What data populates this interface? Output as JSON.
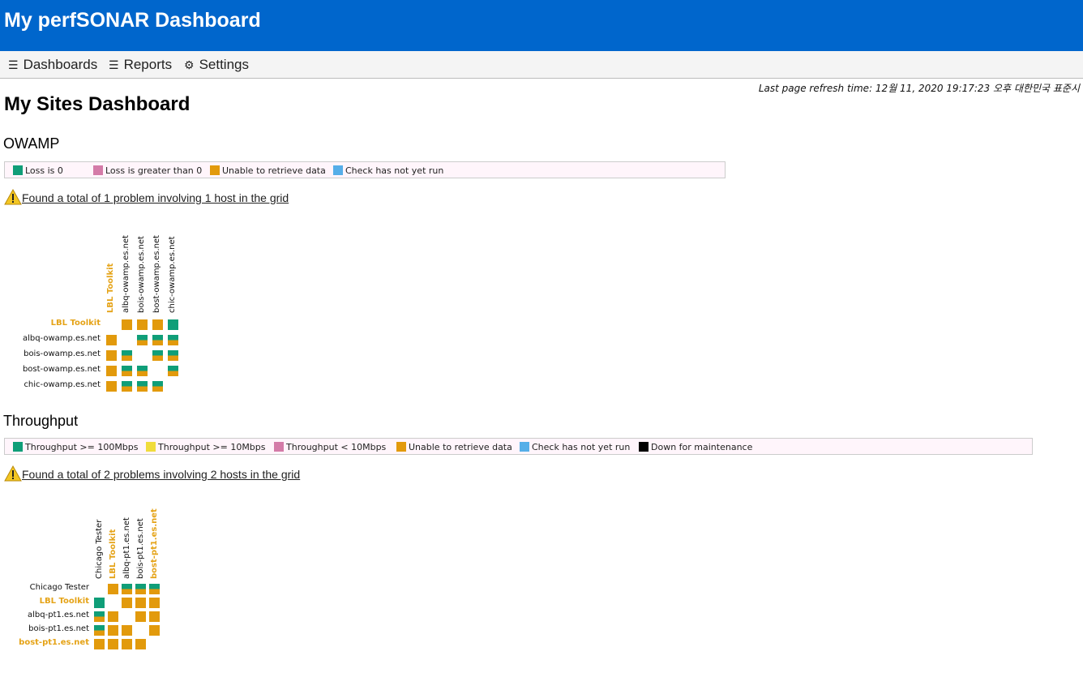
{
  "app": {
    "title": "My perfSONAR Dashboard"
  },
  "nav": [
    {
      "icon": "☰",
      "label": "Dashboards",
      "icon_name": "menu-icon"
    },
    {
      "icon": "☰",
      "label": "Reports",
      "icon_name": "list-icon"
    },
    {
      "icon": "⚙",
      "label": "Settings",
      "icon_name": "gear-icon"
    }
  ],
  "refresh": {
    "text": "Last page refresh time: 12월 11, 2020 19:17:23 오후 대한민국 표준시"
  },
  "page": {
    "title": "My Sites Dashboard"
  },
  "colors": {
    "green": "#0f9e78",
    "pink": "#d47ba8",
    "orange": "#e29a0c",
    "blue": "#55aee8",
    "yellow": "#f0dc3c",
    "black": "#000000",
    "header": "#0066cc",
    "highlight": "#e5a317"
  },
  "owamp": {
    "title": "OWAMP",
    "legend": [
      {
        "color": "green",
        "label": "Loss is 0"
      },
      {
        "color": "pink",
        "label": "Loss is greater than 0"
      },
      {
        "color": "orange",
        "label": "Unable to retrieve data"
      },
      {
        "color": "blue",
        "label": "Check has not yet run"
      }
    ],
    "problem": "Found a total of 1 problem involving 1 host in the grid",
    "hosts": [
      "LBL Toolkit",
      "albq-owamp.es.net",
      "bois-owamp.es.net",
      "bost-owamp.es.net",
      "chic-owamp.es.net"
    ],
    "highlight": [
      true,
      false,
      false,
      false,
      false
    ],
    "cells": [
      [
        null,
        "O",
        "O",
        "O",
        "G"
      ],
      [
        "O",
        null,
        "GO",
        "GO",
        "GO"
      ],
      [
        "O",
        "GO",
        null,
        "GO",
        "GO"
      ],
      [
        "O",
        "GO",
        "GO",
        null,
        "GO"
      ],
      [
        "O",
        "GO",
        "GO",
        "GO",
        null
      ]
    ]
  },
  "throughput": {
    "title": "Throughput",
    "legend": [
      {
        "color": "green",
        "label": "Throughput >= 100Mbps"
      },
      {
        "color": "yellow",
        "label": "Throughput >= 10Mbps"
      },
      {
        "color": "pink",
        "label": "Throughput < 10Mbps"
      },
      {
        "color": "orange",
        "label": "Unable to retrieve data"
      },
      {
        "color": "blue",
        "label": "Check has not yet run"
      },
      {
        "color": "black",
        "label": "Down for maintenance"
      }
    ],
    "problem": "Found a total of 2 problems involving 2 hosts in the grid",
    "hosts": [
      "Chicago Tester",
      "LBL Toolkit",
      "albq-pt1.es.net",
      "bois-pt1.es.net",
      "bost-pt1.es.net"
    ],
    "highlight": [
      false,
      true,
      false,
      false,
      true
    ],
    "cells": [
      [
        null,
        "O",
        "GO",
        "GO",
        "GO"
      ],
      [
        "G",
        null,
        "O",
        "O",
        "O"
      ],
      [
        "GO",
        "O",
        null,
        "O",
        "O"
      ],
      [
        "GO",
        "O",
        "O",
        null,
        "O"
      ],
      [
        "O",
        "O",
        "O",
        "O",
        null
      ]
    ]
  }
}
